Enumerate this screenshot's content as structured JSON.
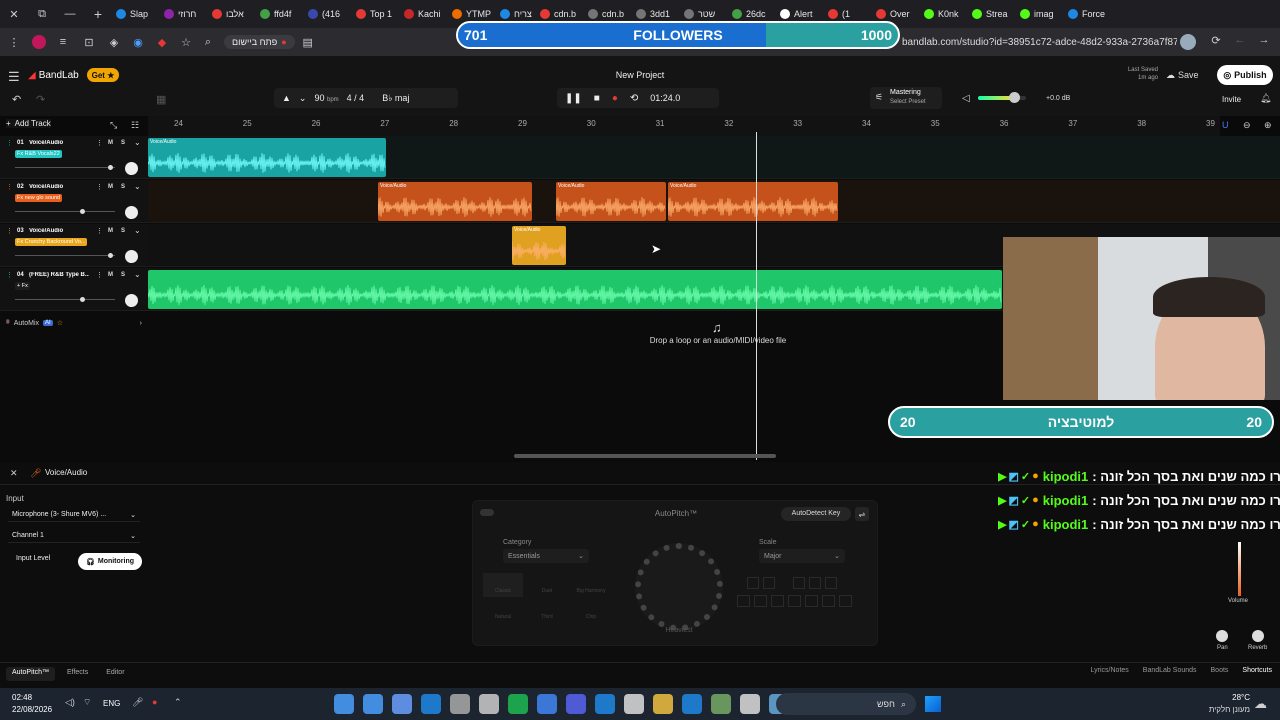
{
  "browser": {
    "tabs": [
      {
        "label": "Slap",
        "color": "#1e88e5"
      },
      {
        "label": "חרוזי",
        "color": "#8e24aa"
      },
      {
        "label": "אלבו",
        "color": "#e53935"
      },
      {
        "label": "ffd4f",
        "color": "#43a047"
      },
      {
        "label": "(416",
        "color": "#3949ab"
      },
      {
        "label": "Top 1",
        "color": "#e53935"
      },
      {
        "label": "Kachi",
        "color": "#c62828"
      },
      {
        "label": "YTMP",
        "color": "#ef6c00"
      },
      {
        "label": "צריח",
        "color": "#1e88e5"
      },
      {
        "label": "cdn.b",
        "color": "#e53935"
      },
      {
        "label": "cdn.b",
        "color": "#757575"
      },
      {
        "label": "3dd1",
        "color": "#757575"
      },
      {
        "label": "שטר",
        "color": "#757575"
      },
      {
        "label": "26dc",
        "color": "#43a047"
      },
      {
        "label": "Alert",
        "color": "#fff"
      },
      {
        "label": "(1",
        "color": "#e53935"
      },
      {
        "label": "Over",
        "color": "#e53935"
      },
      {
        "label": "K0nk",
        "color": "#53fc18"
      },
      {
        "label": "Strea",
        "color": "#53fc18"
      },
      {
        "label": "imag",
        "color": "#53fc18"
      },
      {
        "label": "Force",
        "color": "#1e88e5"
      }
    ],
    "address_prefix": "פתח ביישום",
    "url": "bandlab.com/studio?id=38951c72-adce-48d2-933a-2736a7f870c0"
  },
  "followers": {
    "start": "701",
    "label": "FOLLOWERS",
    "goal": "1000",
    "progress": 0.7
  },
  "header": {
    "logo": "BandLab",
    "get_label": "Get",
    "project_title": "New Project",
    "last_saved": "Last Saved",
    "last_saved_time": "1m ago",
    "save": "Save",
    "publish": "Publish",
    "invite": "Invite"
  },
  "transport": {
    "bpm": "90",
    "bpm_unit": "bpm",
    "time_sig": "4 / 4",
    "key": "B♭ maj",
    "time": "01:24.0"
  },
  "mastering": {
    "label": "Mastering",
    "preset": "Select Preset",
    "volume_db": "+0.0 dB",
    "volume_level": 0.75
  },
  "add_track": "Add Track",
  "ruler": [
    "24",
    "25",
    "26",
    "27",
    "28",
    "29",
    "30",
    "31",
    "32",
    "33",
    "34",
    "35",
    "36",
    "37",
    "38",
    "39"
  ],
  "tracks": [
    {
      "num": "01",
      "name": "Voice/Audio",
      "fx": "Fx R&B Vocals22",
      "fx_color": "#22c4c4",
      "clip_color": "#1aa3a3"
    },
    {
      "num": "02",
      "name": "Voice/Audio",
      "fx": "Fx new glo sound",
      "fx_color": "#e8601c",
      "clip_color": "#e8601c"
    },
    {
      "num": "03",
      "name": "Voice/Audio",
      "fx": "Fx Crunchy Backround Vo...",
      "fx_color": "#e8a71c",
      "clip_color": "#e0a020"
    },
    {
      "num": "04",
      "name": "(FREE) R&B Type B...",
      "fx": "+ Fx",
      "fx_color": "#1e1e1e",
      "clip_color": "#1fc76a"
    }
  ],
  "clip_label": "Voice/Audio",
  "track_buttons": {
    "mute": "M",
    "solo": "S"
  },
  "automix": "AutoMix",
  "ai_badge": "AI",
  "drop_hint": "Drop a loop or an audio/MIDI/video file",
  "motivation": {
    "left": "20",
    "label": "למוטיבציה",
    "right": "20"
  },
  "chat": [
    {
      "user": "kipodi1",
      "text": "ברו כמה שנים ואת בסך הכל זונה :"
    },
    {
      "user": "kipodi1",
      "text": "ברו כמה שנים ואת בסך הכל זונה :"
    },
    {
      "user": "kipodi1",
      "text": "ברו כמה שנים ואת בסך הכל זונה :"
    }
  ],
  "bottom": {
    "track_name": "Voice/Audio",
    "input_label": "Input",
    "microphone": "Microphone (3- Shure MV6) ...",
    "channel": "Channel 1",
    "input_level": "Input Level",
    "monitoring": "Monitoring",
    "autopitch_title": "AutoPitch™",
    "autodetect": "AutoDetect Key",
    "category_label": "Category",
    "category_value": "Essentials",
    "scale_label": "Scale",
    "scale_value": "Major",
    "presets": [
      "Classic",
      "Duet",
      "Big Harmony",
      "Natural",
      "Third",
      "Chip"
    ],
    "knob_label": "Heaviest",
    "volume_label": "Volume",
    "pan_label": "Pan",
    "reverb_label": "Reverb",
    "tabs": [
      "AutoPitch™",
      "Effects",
      "Editor"
    ],
    "right_links": [
      "Lyrics/Notes",
      "BandLab Sounds",
      "Boots",
      "Shortcuts"
    ]
  },
  "taskbar": {
    "time": "02:48",
    "date": "22/08/2026",
    "lang": "ENG",
    "search": "חפש",
    "weather": "28°C",
    "weather_desc": "מעונן חלקית"
  }
}
